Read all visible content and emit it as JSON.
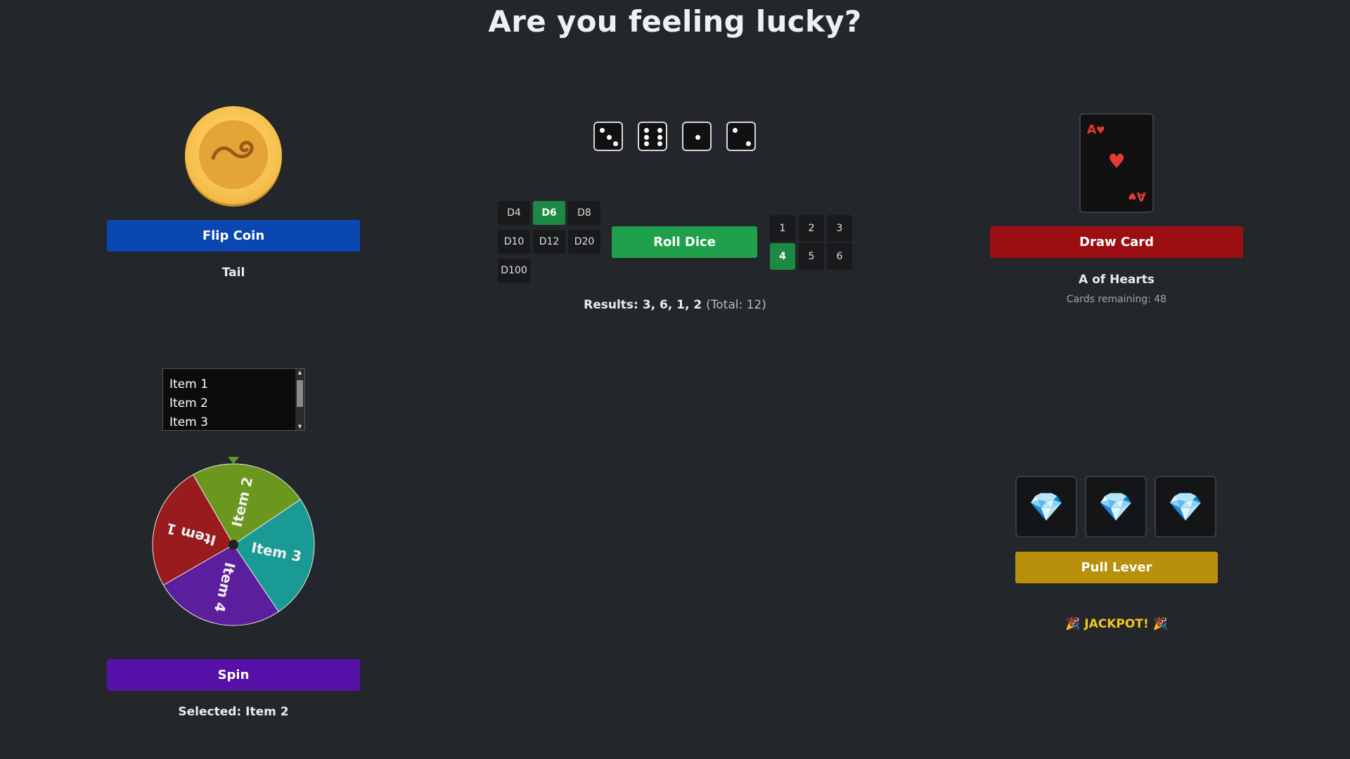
{
  "page": {
    "title": "Are you feeling lucky?"
  },
  "coin": {
    "button_label": "Flip Coin",
    "result": "Tail"
  },
  "dice": {
    "faces": [
      3,
      6,
      1,
      2
    ],
    "types": [
      "D4",
      "D6",
      "D8",
      "D10",
      "D12",
      "D20",
      "D100"
    ],
    "selected_type": "D6",
    "roll_label": "Roll Dice",
    "counts": [
      "1",
      "2",
      "3",
      "4",
      "5",
      "6"
    ],
    "selected_count": "4",
    "results_prefix": "Results: 3, 6, 1, 2",
    "results_total": "(Total: 12)"
  },
  "card": {
    "rank": "A",
    "suit_symbol": "♥",
    "draw_label": "Draw Card",
    "name": "A of Hearts",
    "remaining": "Cards remaining: 48",
    "suit_color": "#e53935"
  },
  "wheel": {
    "list_items": [
      "Item 1",
      "Item 2",
      "Item 3"
    ],
    "segments": [
      {
        "label": "Item 2",
        "color": "#6b971f"
      },
      {
        "label": "Item 3",
        "color": "#1a9a95"
      },
      {
        "label": "Item 4",
        "color": "#5b1f9e"
      },
      {
        "label": "Item 1",
        "color": "#991b1e"
      }
    ],
    "spin_label": "Spin",
    "selected": "Selected: Item 2"
  },
  "slots": {
    "reels": [
      "💎",
      "💎",
      "💎"
    ],
    "lever_label": "Pull Lever",
    "result": "🎉 JACKPOT! 🎉"
  },
  "colors": {
    "background": "#23262a",
    "flip": "#0b47b0",
    "roll": "#1fa04a",
    "draw": "#9b0f12",
    "spin": "#5611a8",
    "lever": "#b8900c",
    "jackpot": "#f5c518"
  }
}
